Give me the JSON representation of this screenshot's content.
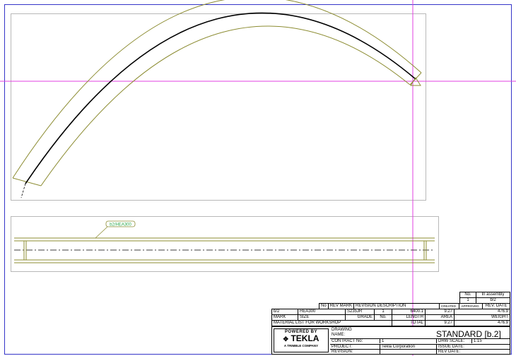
{
  "drawing": {
    "profile_label": "b2/HEA300"
  },
  "revision_table": {
    "headers": [
      "No",
      "REV MARK",
      "REVISION DESCRIPTION",
      "CREATED",
      "APPROVED",
      "REV. DATE"
    ]
  },
  "assembly_box": {
    "no_label": "No.",
    "in_assembly_label": "In assembly",
    "qty": "1",
    "mark": "b/2"
  },
  "material_list": {
    "row": {
      "mark": "b/2",
      "size": "HEA300",
      "grade": "S235JR",
      "no": "1",
      "length": "6400.1",
      "area": "9.27",
      "weight": "476.9"
    },
    "headers": {
      "mark": "MARK",
      "size": "SIZE",
      "grade": "GRADE",
      "no": "No.",
      "length": "LENGTH",
      "area": "AREA",
      "weight": "WEIGHT"
    },
    "footer": {
      "label": "MATERIAL LIST FOR WORKSHOP",
      "total_label": "TOTAL",
      "total_area": "9.27",
      "total_weight": "476.9"
    }
  },
  "title_block": {
    "logo": {
      "powered_by": "POWERED BY",
      "brand": "TEKLA",
      "company": "A TRIMBLE COMPANY"
    },
    "title": "STANDARD  [b.2]",
    "labels": {
      "drawing": "DRAWING",
      "name": "NAME:",
      "contract": "CONTRACT No:",
      "project": "PROJECT:",
      "revision": "REVISION:",
      "drw_scale": "DRW SCALE:",
      "issue_date": "ISSUE DATE:",
      "rev_date": "REV DATE:"
    },
    "values": {
      "contract": "1",
      "project": "Tekla Corporation",
      "scale": "1:15"
    }
  },
  "colors": {
    "profile_outline": "#8c8c32",
    "centerline": "#000000",
    "guide_line": "#e040e0",
    "frame": "#3535c8",
    "label_green": "#2aa84a"
  }
}
